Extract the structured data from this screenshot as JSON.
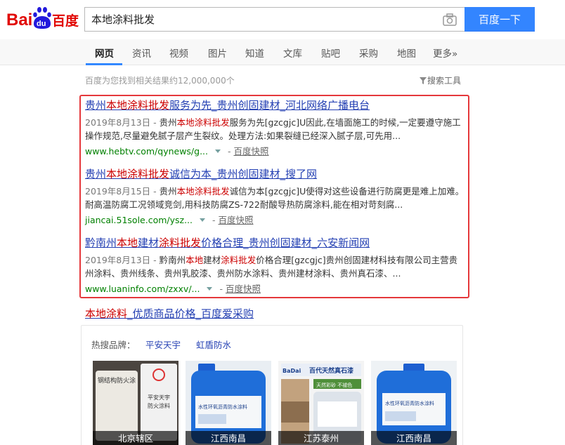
{
  "logo": {
    "text_bai": "Bai",
    "text_du": "du",
    "text_cn": "百度"
  },
  "search": {
    "query": "本地涂料批发",
    "button_label": "百度一下"
  },
  "nav": {
    "tabs": [
      {
        "label": "网页",
        "active": true
      },
      {
        "label": "资讯"
      },
      {
        "label": "视频"
      },
      {
        "label": "图片"
      },
      {
        "label": "知道"
      },
      {
        "label": "文库"
      },
      {
        "label": "贴吧"
      },
      {
        "label": "采购"
      },
      {
        "label": "地图"
      },
      {
        "label": "更多»"
      }
    ]
  },
  "result_count": "百度为您找到相关结果约12,000,000个",
  "search_tools": "搜索工具",
  "results": [
    {
      "title_pre": "贵州",
      "title_em": "本地涂料批发",
      "title_post": "服务为先_贵州创固建材_河北网络广播电台",
      "date": "2019年8月13日 - ",
      "abs_pre": "贵州",
      "abs_em": "本地涂料批发",
      "abs_post": "服务为先[gzcgjc]U因此,在墙面施工的时候,一定要遵守施工操作规范,尽量避免腻子层产生裂纹。处理方法:如果裂缝已经深入腻子层,可先用...",
      "url": "www.hebtv.com/qynews/g...",
      "sep": " - ",
      "cache": "百度快照"
    },
    {
      "title_pre": "贵州",
      "title_em": "本地涂料批发",
      "title_post": "诚信为本_贵州创固建材_搜了网",
      "date": "2019年8月15日 - ",
      "abs_pre": "贵州",
      "abs_em": "本地涂料批发",
      "abs_post": "诚信为本[gzcgjc]U使得对这些设备进行防腐更是难上加难。耐高温防腐工况领域竞剑,用科技防腐ZS-722耐酸导热防腐涂料,能在相对苛刻腐...",
      "url": "jiancai.51sole.com/ysz...",
      "sep": " - ",
      "cache": "百度快照"
    },
    {
      "title_pre": "黔南州",
      "title_em": "本地",
      "title_mid": "建材",
      "title_em2": "涂料批发",
      "title_post": "价格合理_贵州创固建材_六安新闻网",
      "date": "2019年8月13日 - ",
      "abs_pre": "黔南州",
      "abs_em": "本地",
      "abs_mid": "建材",
      "abs_em2": "涂料批发",
      "abs_post": "价格合理[gzcgjc]贵州创固建材科技有限公司主营贵州涂料、贵州线条、贵州乳胶漆、贵州防水涂料、贵州建材涂料、贵州真石漆、...",
      "url": "www.luaninfo.com/zxxv/...",
      "sep": " - ",
      "cache": "百度快照"
    }
  ],
  "aicaigou": {
    "title_em": "本地涂料",
    "title_post": "_优质商品价格_百度爱采购",
    "hot_label": "热搜品牌：",
    "brands": [
      "平安天宇",
      "虹盾防水"
    ],
    "products": [
      {
        "caption": "北京辖区",
        "img_text_top": "钢结构防火涂",
        "img_text_mid": "平安天宇",
        "img_text_sub": "防火涂料"
      },
      {
        "caption": "江西南昌",
        "img_text_top": "水性环氧沥青防水涂料"
      },
      {
        "caption": "江苏泰州",
        "img_text_top": "百代天然真石漆",
        "img_text_mid": "天然彩砂 不褪色",
        "img_text_sub": "BaDai"
      },
      {
        "caption": "江西南昌",
        "img_text_top": "水性环氧沥青防水涂料"
      }
    ]
  }
}
